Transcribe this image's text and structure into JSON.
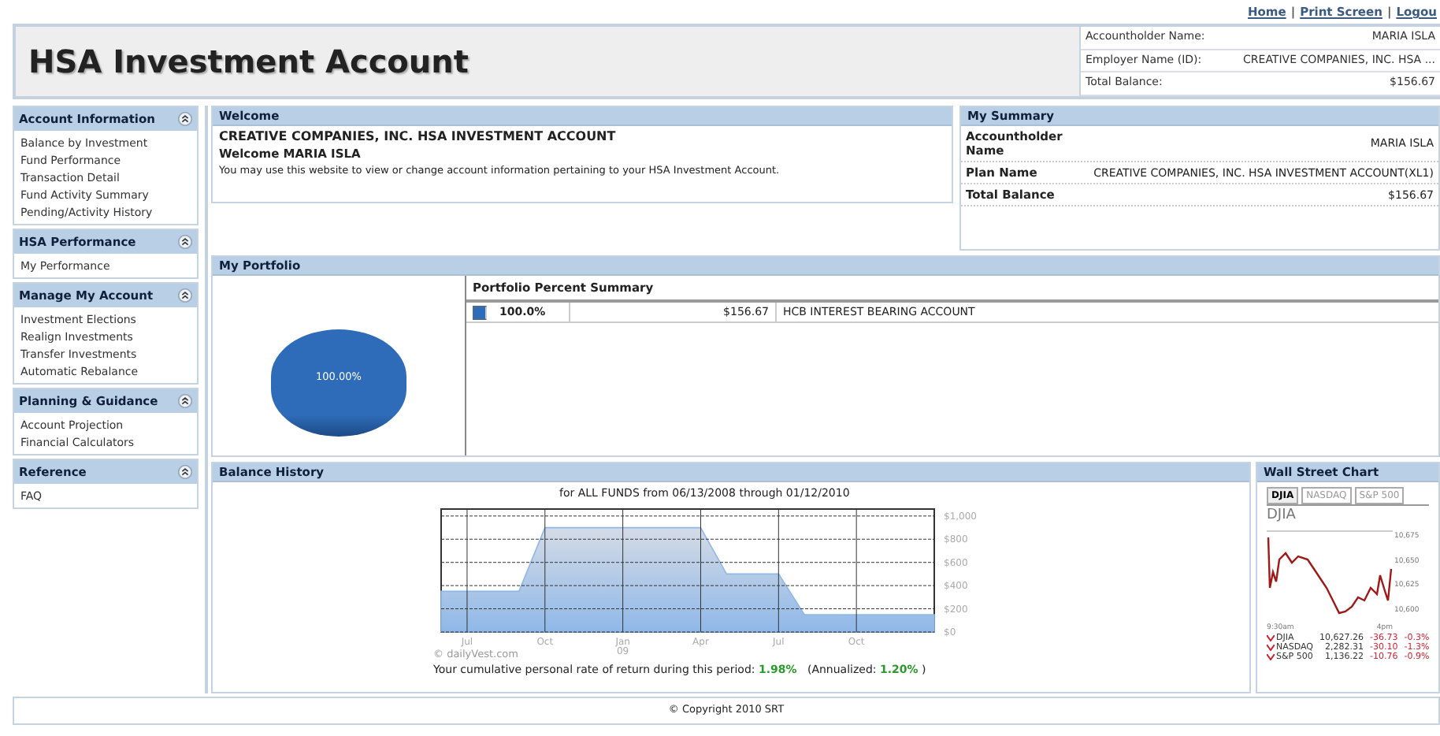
{
  "top_links": [
    "Home",
    "Print Screen",
    "Logou"
  ],
  "link_separator": "|",
  "header": {
    "title": "HSA Investment Account",
    "info": [
      {
        "label": "Accountholder Name:",
        "value": "MARIA ISLA"
      },
      {
        "label": "Employer Name (ID):",
        "value": "CREATIVE COMPANIES, INC. HSA ..."
      },
      {
        "label": "Total Balance:",
        "value": "$156.67"
      }
    ]
  },
  "sidebar": [
    {
      "title": "Account Information",
      "items": [
        "Balance by Investment",
        "Fund Performance",
        "Transaction Detail",
        "Fund Activity Summary",
        "Pending/Activity History"
      ]
    },
    {
      "title": "HSA Performance",
      "items": [
        "My Performance"
      ]
    },
    {
      "title": "Manage My Account",
      "items": [
        "Investment Elections",
        "Realign Investments",
        "Transfer Investments",
        "Automatic Rebalance"
      ]
    },
    {
      "title": "Planning & Guidance",
      "items": [
        "Account Projection",
        "Financial Calculators"
      ]
    },
    {
      "title": "Reference",
      "items": [
        "FAQ"
      ]
    }
  ],
  "welcome": {
    "title": "Welcome",
    "heading": "CREATIVE COMPANIES, INC. HSA INVESTMENT ACCOUNT",
    "greeting": "Welcome MARIA ISLA",
    "text": "You may use this website to view or change account information pertaining to your HSA Investment Account."
  },
  "summary": {
    "title": "My Summary",
    "rows": [
      {
        "label": "Accountholder Name",
        "value": "MARIA ISLA"
      },
      {
        "label": "Plan Name",
        "value": "CREATIVE COMPANIES, INC. HSA INVESTMENT ACCOUNT(XL1)"
      },
      {
        "label": "Total Balance",
        "value": "$156.67"
      }
    ]
  },
  "portfolio": {
    "title": "My Portfolio",
    "chart_data": {
      "type": "pie",
      "values": [
        100
      ],
      "value_labels": [
        "100.00%"
      ]
    },
    "table_title": "Portfolio Percent Summary",
    "rows": [
      {
        "color": "#2e6bb8",
        "percent": "100.0%",
        "amount": "$156.67",
        "fund": "HCB INTEREST BEARING ACCOUNT"
      }
    ]
  },
  "balance_history": {
    "title": "Balance History",
    "subtitle": "for ALL FUNDS from 06/13/2008 through 01/12/2010",
    "chart_data": {
      "type": "area",
      "categories": [
        null,
        "Jul",
        null,
        null,
        "Oct",
        null,
        null,
        "Jan 09",
        null,
        null,
        "Apr",
        null,
        null,
        "Jul",
        null,
        null,
        "Oct",
        null,
        null,
        null
      ],
      "series": [
        {
          "color": "#8fb8e8",
          "values": [
            350,
            350,
            350,
            350,
            900,
            900,
            900,
            900,
            900,
            900,
            900,
            500,
            500,
            500,
            150,
            150,
            150,
            150,
            150,
            150
          ]
        }
      ],
      "ylim": [
        0,
        1060
      ],
      "grid": true,
      "yticks": [
        {
          "value": 0,
          "label": "$0"
        },
        {
          "value": 200,
          "label": "$200"
        },
        {
          "value": 400,
          "label": "$400"
        },
        {
          "value": 600,
          "label": "$600"
        },
        {
          "value": 800,
          "label": "$800"
        },
        {
          "value": 1000,
          "label": "$1,000"
        }
      ]
    },
    "credit": "© dailyVest.com",
    "return_text": "Your cumulative personal rate of return during this period:",
    "return_value": "1.98%",
    "annualized_label": "(Annualized:",
    "annualized_value": "1.20%",
    "annualized_close": ")"
  },
  "wall_street": {
    "title": "Wall Street Chart",
    "tabs": [
      {
        "label": "DJIA",
        "selected": true
      },
      {
        "label": "NASDAQ",
        "selected": false
      },
      {
        "label": "S&P 500",
        "selected": false
      }
    ],
    "chart_title": "DJIA",
    "y_labels": [
      "10,675",
      "10,650",
      "10,625",
      "10,600"
    ],
    "time_start": "9:30am",
    "time_end": "4pm",
    "indexes": [
      {
        "name": "DJIA",
        "value": "10,627.26",
        "change": "-36.73",
        "percent": "-0.3%"
      },
      {
        "name": "NASDAQ",
        "value": "2,282.31",
        "change": "-30.10",
        "percent": "-1.3%"
      },
      {
        "name": "S&P 500",
        "value": "1,136.22",
        "change": "-10.76",
        "percent": "-0.9%"
      }
    ]
  },
  "footer": "© Copyright 2010 SRT"
}
